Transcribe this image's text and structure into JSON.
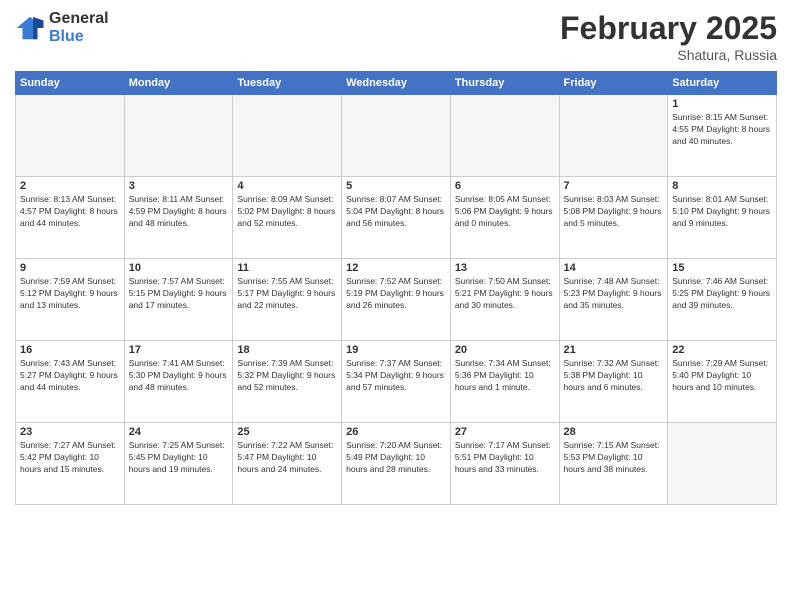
{
  "logo": {
    "general": "General",
    "blue": "Blue"
  },
  "title": {
    "month_year": "February 2025",
    "location": "Shatura, Russia"
  },
  "weekdays": [
    "Sunday",
    "Monday",
    "Tuesday",
    "Wednesday",
    "Thursday",
    "Friday",
    "Saturday"
  ],
  "weeks": [
    {
      "days": [
        {
          "num": "",
          "info": ""
        },
        {
          "num": "",
          "info": ""
        },
        {
          "num": "",
          "info": ""
        },
        {
          "num": "",
          "info": ""
        },
        {
          "num": "",
          "info": ""
        },
        {
          "num": "",
          "info": ""
        },
        {
          "num": "1",
          "info": "Sunrise: 8:15 AM\nSunset: 4:55 PM\nDaylight: 8 hours and 40 minutes."
        }
      ]
    },
    {
      "days": [
        {
          "num": "2",
          "info": "Sunrise: 8:13 AM\nSunset: 4:57 PM\nDaylight: 8 hours and 44 minutes."
        },
        {
          "num": "3",
          "info": "Sunrise: 8:11 AM\nSunset: 4:59 PM\nDaylight: 8 hours and 48 minutes."
        },
        {
          "num": "4",
          "info": "Sunrise: 8:09 AM\nSunset: 5:02 PM\nDaylight: 8 hours and 52 minutes."
        },
        {
          "num": "5",
          "info": "Sunrise: 8:07 AM\nSunset: 5:04 PM\nDaylight: 8 hours and 56 minutes."
        },
        {
          "num": "6",
          "info": "Sunrise: 8:05 AM\nSunset: 5:06 PM\nDaylight: 9 hours and 0 minutes."
        },
        {
          "num": "7",
          "info": "Sunrise: 8:03 AM\nSunset: 5:08 PM\nDaylight: 9 hours and 5 minutes."
        },
        {
          "num": "8",
          "info": "Sunrise: 8:01 AM\nSunset: 5:10 PM\nDaylight: 9 hours and 9 minutes."
        }
      ]
    },
    {
      "days": [
        {
          "num": "9",
          "info": "Sunrise: 7:59 AM\nSunset: 5:12 PM\nDaylight: 9 hours and 13 minutes."
        },
        {
          "num": "10",
          "info": "Sunrise: 7:57 AM\nSunset: 5:15 PM\nDaylight: 9 hours and 17 minutes."
        },
        {
          "num": "11",
          "info": "Sunrise: 7:55 AM\nSunset: 5:17 PM\nDaylight: 9 hours and 22 minutes."
        },
        {
          "num": "12",
          "info": "Sunrise: 7:52 AM\nSunset: 5:19 PM\nDaylight: 9 hours and 26 minutes."
        },
        {
          "num": "13",
          "info": "Sunrise: 7:50 AM\nSunset: 5:21 PM\nDaylight: 9 hours and 30 minutes."
        },
        {
          "num": "14",
          "info": "Sunrise: 7:48 AM\nSunset: 5:23 PM\nDaylight: 9 hours and 35 minutes."
        },
        {
          "num": "15",
          "info": "Sunrise: 7:46 AM\nSunset: 5:25 PM\nDaylight: 9 hours and 39 minutes."
        }
      ]
    },
    {
      "days": [
        {
          "num": "16",
          "info": "Sunrise: 7:43 AM\nSunset: 5:27 PM\nDaylight: 9 hours and 44 minutes."
        },
        {
          "num": "17",
          "info": "Sunrise: 7:41 AM\nSunset: 5:30 PM\nDaylight: 9 hours and 48 minutes."
        },
        {
          "num": "18",
          "info": "Sunrise: 7:39 AM\nSunset: 5:32 PM\nDaylight: 9 hours and 52 minutes."
        },
        {
          "num": "19",
          "info": "Sunrise: 7:37 AM\nSunset: 5:34 PM\nDaylight: 9 hours and 57 minutes."
        },
        {
          "num": "20",
          "info": "Sunrise: 7:34 AM\nSunset: 5:36 PM\nDaylight: 10 hours and 1 minute."
        },
        {
          "num": "21",
          "info": "Sunrise: 7:32 AM\nSunset: 5:38 PM\nDaylight: 10 hours and 6 minutes."
        },
        {
          "num": "22",
          "info": "Sunrise: 7:29 AM\nSunset: 5:40 PM\nDaylight: 10 hours and 10 minutes."
        }
      ]
    },
    {
      "days": [
        {
          "num": "23",
          "info": "Sunrise: 7:27 AM\nSunset: 5:42 PM\nDaylight: 10 hours and 15 minutes."
        },
        {
          "num": "24",
          "info": "Sunrise: 7:25 AM\nSunset: 5:45 PM\nDaylight: 10 hours and 19 minutes."
        },
        {
          "num": "25",
          "info": "Sunrise: 7:22 AM\nSunset: 5:47 PM\nDaylight: 10 hours and 24 minutes."
        },
        {
          "num": "26",
          "info": "Sunrise: 7:20 AM\nSunset: 5:49 PM\nDaylight: 10 hours and 28 minutes."
        },
        {
          "num": "27",
          "info": "Sunrise: 7:17 AM\nSunset: 5:51 PM\nDaylight: 10 hours and 33 minutes."
        },
        {
          "num": "28",
          "info": "Sunrise: 7:15 AM\nSunset: 5:53 PM\nDaylight: 10 hours and 38 minutes."
        },
        {
          "num": "",
          "info": ""
        }
      ]
    }
  ]
}
